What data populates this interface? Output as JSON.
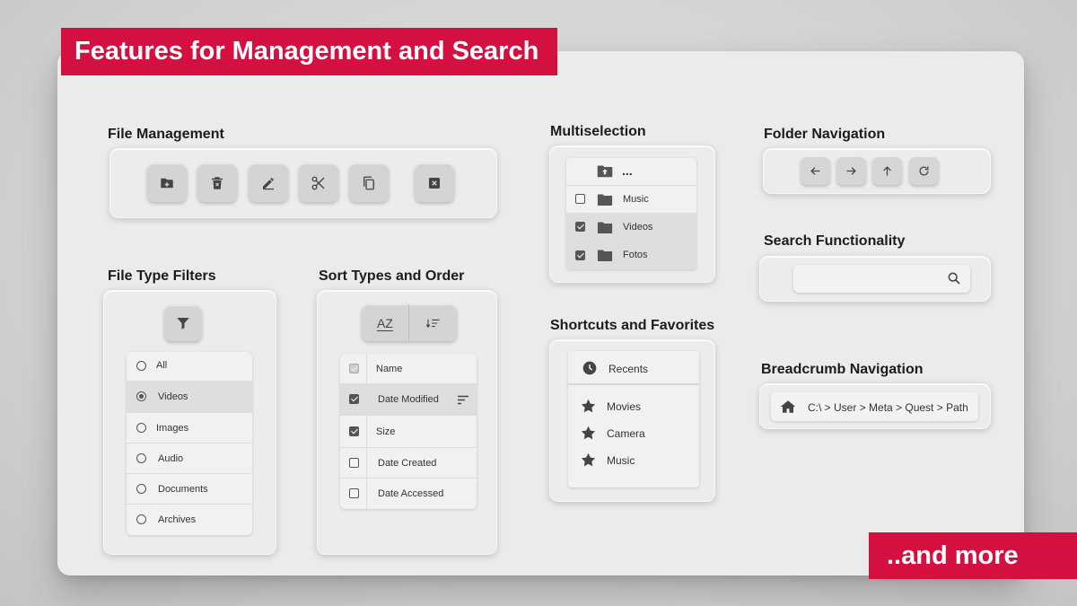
{
  "header": {
    "title": "Features for Management and Search"
  },
  "footer": {
    "more_label": "..and more"
  },
  "file_management": {
    "title": "File Management",
    "buttons": [
      {
        "icon": "new-folder-icon"
      },
      {
        "icon": "delete-icon"
      },
      {
        "icon": "rename-icon"
      },
      {
        "icon": "cut-icon"
      },
      {
        "icon": "copy-icon"
      },
      {
        "icon": "close-icon"
      }
    ]
  },
  "multiselection": {
    "title": "Multiselection",
    "parent_label": "...",
    "items": [
      {
        "label": "Music",
        "checked": false
      },
      {
        "label": "Videos",
        "checked": true
      },
      {
        "label": "Fotos",
        "checked": true
      }
    ]
  },
  "folder_navigation": {
    "title": "Folder Navigation",
    "buttons": [
      "back-arrow-icon",
      "forward-arrow-icon",
      "up-arrow-icon",
      "refresh-icon"
    ]
  },
  "search": {
    "title": "Search Functionality",
    "placeholder": "",
    "icon": "search-icon"
  },
  "breadcrumb": {
    "title": "Breadcrumb Navigation",
    "path": "C:\\ > User > Meta > Quest > Path"
  },
  "file_type_filters": {
    "title": "File Type Filters",
    "options": [
      {
        "label": "All",
        "selected": false
      },
      {
        "label": "Videos",
        "selected": true
      },
      {
        "label": "Images",
        "selected": false
      },
      {
        "label": "Audio",
        "selected": false
      },
      {
        "label": "Documents",
        "selected": false
      },
      {
        "label": "Archives",
        "selected": false
      }
    ]
  },
  "sort": {
    "title": "Sort Types and Order",
    "az_label": "AZ",
    "fields": [
      {
        "label": "Name",
        "checked": true,
        "disabled": true
      },
      {
        "label": "Date Modified",
        "checked": true,
        "active": true
      },
      {
        "label": "Size",
        "checked": true
      },
      {
        "label": "Date Created",
        "checked": false
      },
      {
        "label": "Date Accessed",
        "checked": false
      }
    ]
  },
  "shortcuts": {
    "title": "Shortcuts and Favorites",
    "recents_label": "Recents",
    "favorites": [
      {
        "label": "Movies"
      },
      {
        "label": "Camera"
      },
      {
        "label": "Music"
      }
    ]
  }
}
